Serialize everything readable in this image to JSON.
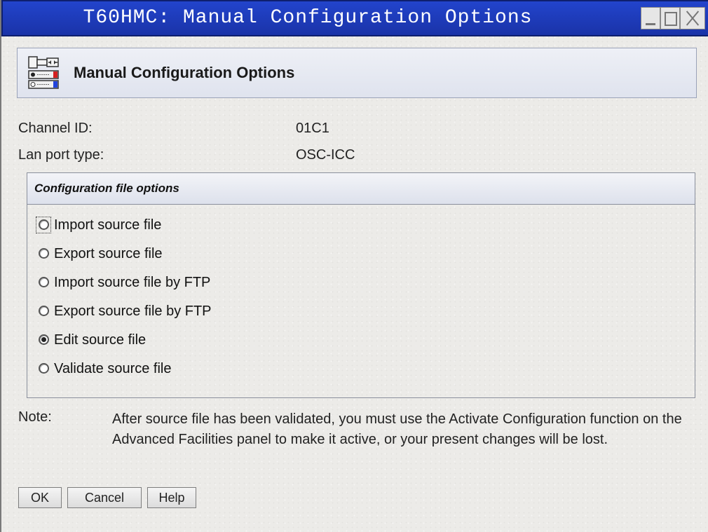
{
  "window": {
    "title": "T60HMC: Manual Configuration Options",
    "title_bar_color": "#1a33a8"
  },
  "header": {
    "title": "Manual Configuration Options",
    "icon": "configuration-panel-icon"
  },
  "info": {
    "channel_id_label": "Channel ID:",
    "channel_id_value": "01C1",
    "lan_port_label": "Lan port type:",
    "lan_port_value": "OSC-ICC"
  },
  "config_group": {
    "title": "Configuration file options",
    "options": [
      {
        "label": "Import source file",
        "selected": false,
        "focused": true
      },
      {
        "label": "Export source file",
        "selected": false
      },
      {
        "label": "Import source file by FTP",
        "selected": false
      },
      {
        "label": "Export source file by FTP",
        "selected": false
      },
      {
        "label": "Edit source file",
        "selected": true
      },
      {
        "label": "Validate source file",
        "selected": false
      }
    ]
  },
  "note": {
    "label": "Note:",
    "text": "After source file has been validated, you must use the Activate Configuration function on the Advanced Facilities panel to make it active, or your present changes will be lost."
  },
  "buttons": {
    "ok": "OK",
    "cancel": "Cancel",
    "help": "Help"
  }
}
